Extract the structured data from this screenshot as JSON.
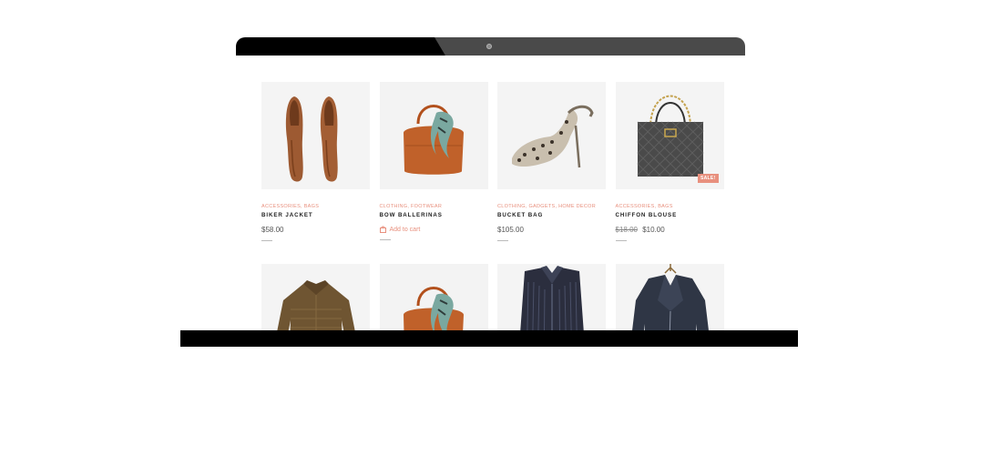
{
  "products": [
    {
      "categories": "ACCESSORIES, BAGS",
      "title": "BIKER JACKET",
      "price": "$58.00",
      "image": "brown-oxford-shoes"
    },
    {
      "categories": "CLOTHING, FOOTWEAR",
      "title": "BOW BALLERINAS",
      "action": "Add to cart",
      "image": "orange-handbag-with-scarf"
    },
    {
      "categories": "CLOTHING, GADGETS, HOME DECOR",
      "title": "BUCKET BAG",
      "price": "$105.00",
      "image": "leopard-heels"
    },
    {
      "categories": "ACCESSORIES, BAGS",
      "title": "CHIFFON BLOUSE",
      "old_price": "$18.00",
      "price": "$10.00",
      "badge": "SALE!",
      "image": "quilted-chain-bag"
    },
    {
      "image": "brown-quilted-jacket"
    },
    {
      "image": "orange-handbag-with-scarf"
    },
    {
      "image": "striped-dress-shirt"
    },
    {
      "image": "leather-biker-jacket"
    }
  ],
  "colors": {
    "accent": "#e8907e",
    "frame": "#000000",
    "frame_grey": "#4a4a4a"
  }
}
